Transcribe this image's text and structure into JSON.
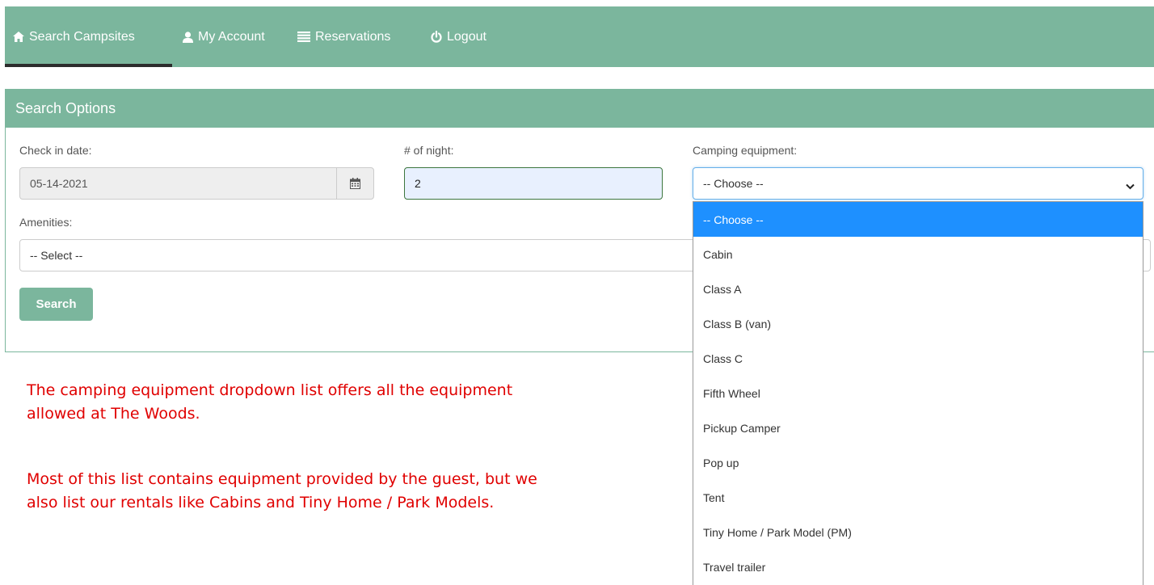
{
  "nav": {
    "items": [
      {
        "label": "Search Campsites",
        "icon": "home-icon"
      },
      {
        "label": "My Account",
        "icon": "user-icon"
      },
      {
        "label": "Reservations",
        "icon": "list-icon"
      },
      {
        "label": "Logout",
        "icon": "power-icon"
      }
    ],
    "active": "Search Campsites"
  },
  "panel": {
    "title": "Search Options"
  },
  "form": {
    "checkin_label": "Check in date:",
    "checkin_value": "05-14-2021",
    "nights_label": "# of night:",
    "nights_value": "2",
    "equipment_label": "Camping equipment:",
    "equipment_value": "-- Choose --",
    "amenities_label": "Amenities:",
    "amenities_value": "-- Select --",
    "search_button": "Search"
  },
  "equipment_options": [
    "-- Choose --",
    "Cabin",
    "Class A",
    "Class B (van)",
    "Class C",
    "Fifth Wheel",
    "Pickup Camper",
    "Pop up",
    "Tent",
    "Tiny Home / Park Model (PM)",
    "Travel trailer"
  ],
  "annotation": {
    "para1_line1": "The camping equipment dropdown list offers all the equipment",
    "para1_line2": "allowed at The Woods.",
    "para2_line1": "Most of this list contains equipment provided by the guest, but we",
    "para2_line2": "also list our rentals like Cabins and Tiny Home / Park Models."
  },
  "colors": {
    "brand": "#7bb69d",
    "selected": "#1e90ff",
    "annotation": "#e00000"
  }
}
